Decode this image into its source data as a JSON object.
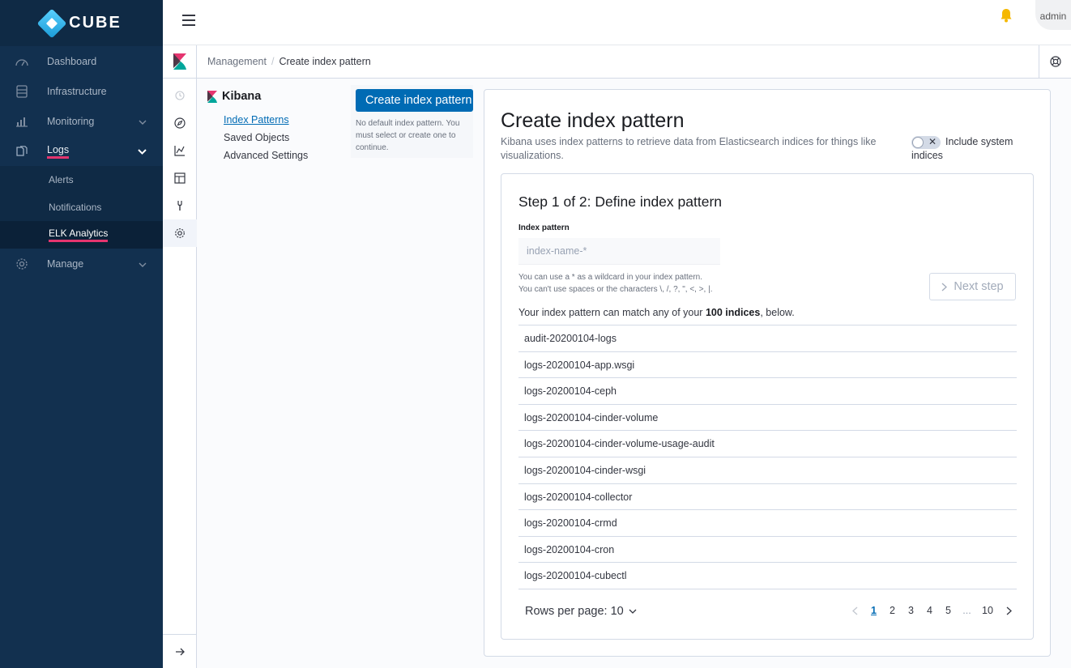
{
  "brand": {
    "name": "CUBE"
  },
  "sidebar": {
    "items": [
      {
        "label": "Dashboard",
        "icon": "dashboard-icon"
      },
      {
        "label": "Infrastructure",
        "icon": "server-icon"
      },
      {
        "label": "Monitoring",
        "icon": "chart-icon"
      },
      {
        "label": "Logs",
        "icon": "logs-icon"
      },
      {
        "label": "Manage",
        "icon": "gear-icon"
      }
    ],
    "logs_children": [
      {
        "label": "Alerts"
      },
      {
        "label": "Notifications"
      },
      {
        "label": "ELK Analytics"
      }
    ]
  },
  "topbar": {
    "user": "admin"
  },
  "breadcrumb": {
    "root": "Management",
    "current": "Create index pattern"
  },
  "mgmt_nav": {
    "title": "Kibana",
    "links": [
      "Index Patterns",
      "Saved Objects",
      "Advanced Settings"
    ]
  },
  "create_panel": {
    "button": "Create index pattern",
    "note": "No default index pattern. You must select or create one to continue."
  },
  "main": {
    "title": "Create index pattern",
    "subtitle": "Kibana uses index patterns to retrieve data from Elasticsearch indices for things like visualizations.",
    "system_toggle": "Include system indices",
    "step_title": "Step 1 of 2: Define index pattern",
    "field_label": "Index pattern",
    "field_placeholder": "index-name-*",
    "help_line1": "You can use a * as a wildcard in your index pattern.",
    "help_line2": "You can't use spaces or the characters \\, /, ?, \", <, >, |.",
    "next_button": "Next step",
    "match_prefix": "Your index pattern can match any of your ",
    "match_count": "100 indices",
    "match_suffix": ", below.",
    "indices": [
      "audit-20200104-logs",
      "logs-20200104-app.wsgi",
      "logs-20200104-ceph",
      "logs-20200104-cinder-volume",
      "logs-20200104-cinder-volume-usage-audit",
      "logs-20200104-cinder-wsgi",
      "logs-20200104-collector",
      "logs-20200104-crmd",
      "logs-20200104-cron",
      "logs-20200104-cubectl"
    ],
    "rows_per_page": "Rows per page: 10",
    "pages": [
      "1",
      "2",
      "3",
      "4",
      "5",
      "...",
      "10"
    ],
    "current_page": "1"
  },
  "colors": {
    "sidebar_bg": "#12304f",
    "accent": "#006bb4",
    "active_underline": "#e5356f",
    "bell": "#f5b800"
  }
}
